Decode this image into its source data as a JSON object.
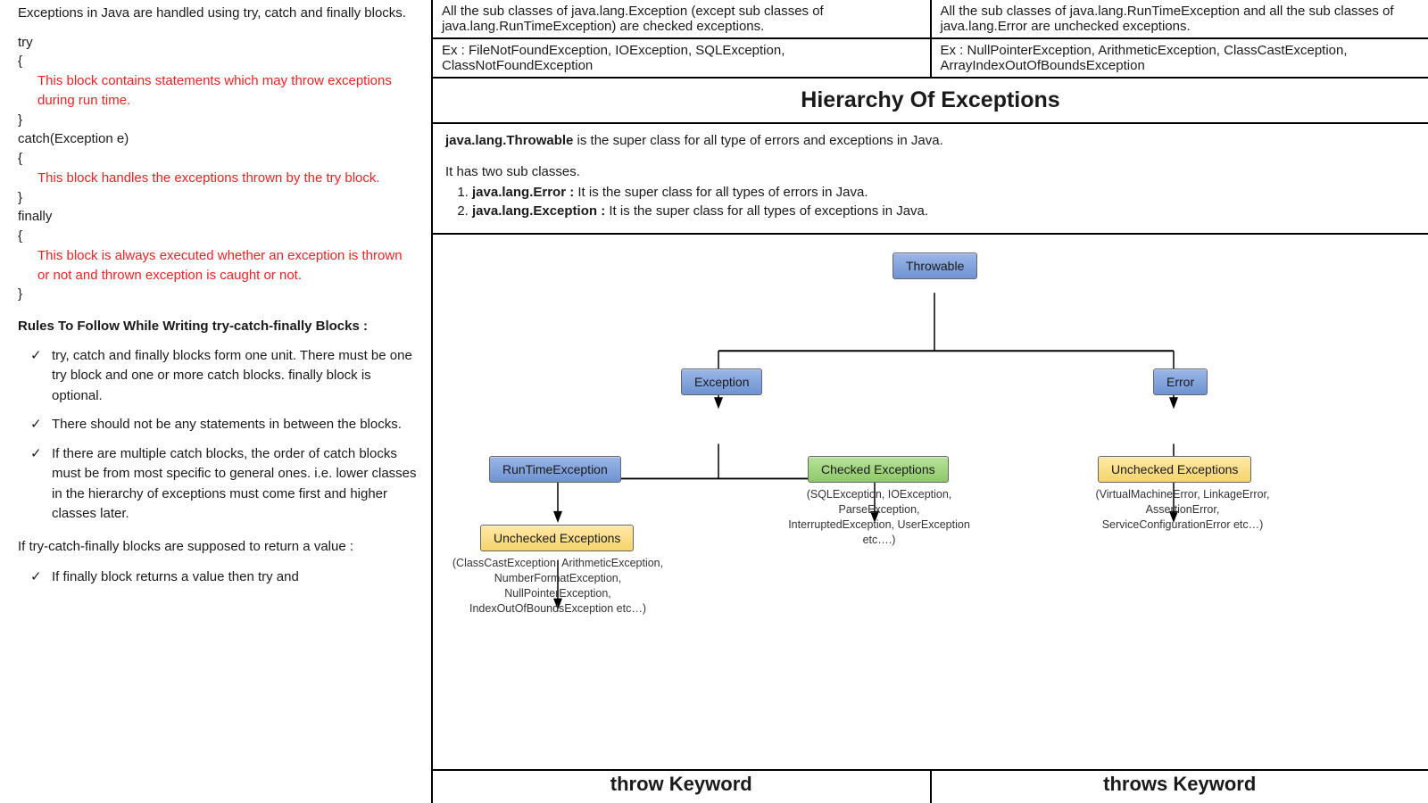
{
  "left": {
    "intro": "Exceptions in Java are handled using try, catch and finally blocks.",
    "code": {
      "try": "try",
      "ob1": "{",
      "tryComment": "This block contains statements which may throw exceptions during run time.",
      "cb1": "}",
      "catch": "catch(Exception e)",
      "ob2": "{",
      "catchComment": "This block handles the exceptions thrown by the try block.",
      "cb2": "}",
      "finally": "finally",
      "ob3": "{",
      "finallyComment": "This block is always executed whether an exception is thrown or not and thrown exception is caught or not.",
      "cb3": "}"
    },
    "rulesHeading": "Rules To Follow While Writing try-catch-finally Blocks :",
    "rules": [
      "try, catch and finally blocks form one unit. There must be one try block and one or more catch blocks. finally block is optional.",
      "There should not be any statements in between the blocks.",
      "If there are multiple catch blocks, the order of catch blocks must be from most specific to general ones. i.e. lower classes in the hierarchy of exceptions must come first and higher classes later."
    ],
    "returnHeading": "If try-catch-finally blocks are supposed to return a value :",
    "returnNote": "If finally block returns a value then try and"
  },
  "table": {
    "r1c1": "All the sub classes of java.lang.Exception (except sub classes of java.lang.RunTimeException) are checked exceptions.",
    "r1c2": "All the sub classes of java.lang.RunTimeException and all the sub classes of java.lang.Error are unchecked exceptions.",
    "r2c1": "Ex : FileNotFoundException, IOException, SQLException, ClassNotFoundException",
    "r2c2": "Ex : NullPointerException, ArithmeticException, ClassCastException, ArrayIndexOutOfBoundsException"
  },
  "hierarchy": {
    "title": "Hierarchy Of Exceptions",
    "boldLead": "java.lang.Throwable",
    "lead": " is the super class for all type of errors and exceptions in Java.",
    "sub": "It has two sub classes.",
    "li1b": "java.lang.Error : ",
    "li1": "It is the super class for all types of errors in Java.",
    "li2b": "java.lang.Exception : ",
    "li2": "It is the super class for all types of exceptions in Java."
  },
  "diagram": {
    "throwable": "Throwable",
    "exception": "Exception",
    "error": "Error",
    "runtime": "RunTimeException",
    "checked": "Checked Exceptions",
    "uncheckedRt": "Unchecked Exceptions",
    "uncheckedErr": "Unchecked Exceptions",
    "rtCaption": "(ClassCastException, ArithmeticException, NumberFormatException, NullPointerException, IndexOutOfBoundsException etc…)",
    "checkedCaption": "(SQLException, IOException, ParseException, InterruptedException, UserException etc….)",
    "errCaption": "(VirtualMachineError, LinkageError, AssertionError, ServiceConfigurationError etc…)"
  },
  "footer": {
    "left": "throw Keyword",
    "right": "throws Keyword"
  }
}
